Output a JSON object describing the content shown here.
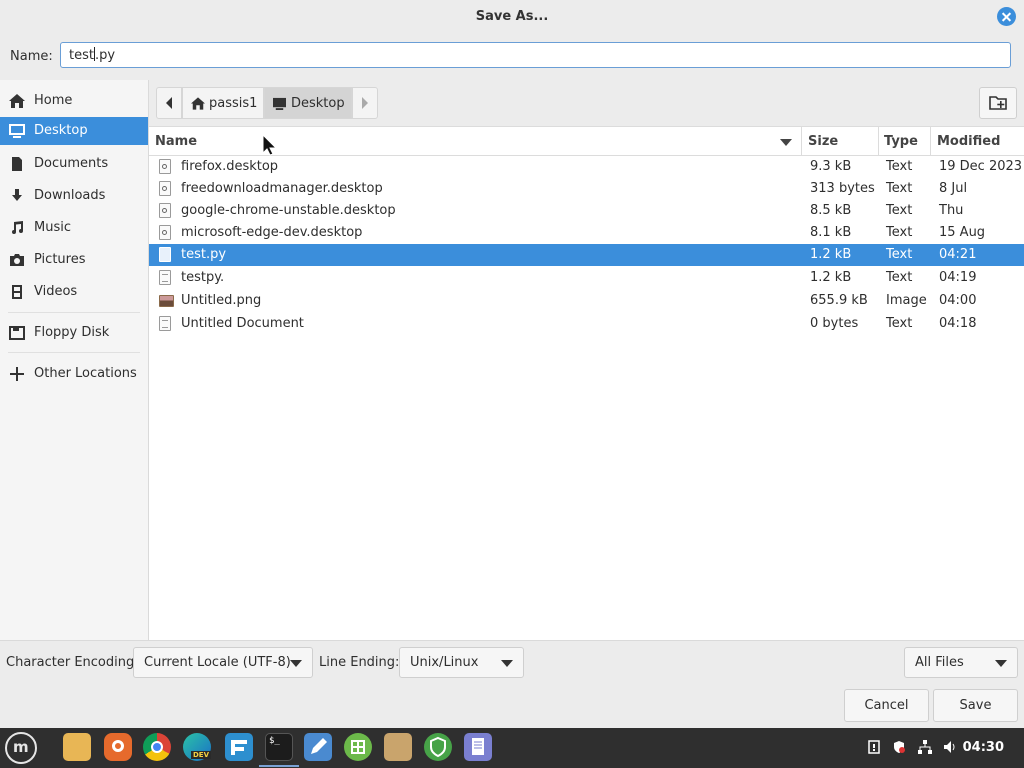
{
  "window": {
    "title": "Save As..."
  },
  "name_row": {
    "label": "Name:",
    "value_before_caret": "test",
    "value_after_caret": ".py"
  },
  "sidebar": {
    "items": [
      {
        "label": "Home",
        "icon": "home-icon"
      },
      {
        "label": "Desktop",
        "icon": "desktop-icon",
        "active": true
      },
      {
        "label": "Documents",
        "icon": "documents-icon"
      },
      {
        "label": "Downloads",
        "icon": "downloads-icon"
      },
      {
        "label": "Music",
        "icon": "music-icon"
      },
      {
        "label": "Pictures",
        "icon": "pictures-icon"
      },
      {
        "label": "Videos",
        "icon": "videos-icon"
      },
      {
        "label": "Floppy Disk",
        "icon": "floppy-disk-icon"
      },
      {
        "label": "Other Locations",
        "icon": "plus-icon"
      }
    ]
  },
  "pathbar": {
    "crumbs": [
      "passis1",
      "Desktop"
    ]
  },
  "file_list": {
    "columns": [
      "Name",
      "Size",
      "Type",
      "Modified"
    ],
    "rows": [
      {
        "name": "firefox.desktop",
        "size": "9.3 kB",
        "type": "Text",
        "modified": "19 Dec 2023",
        "icon": "desktop-file-icon"
      },
      {
        "name": "freedownloadmanager.desktop",
        "size": "313 bytes",
        "type": "Text",
        "modified": "8 Jul",
        "icon": "desktop-file-icon"
      },
      {
        "name": "google-chrome-unstable.desktop",
        "size": "8.5 kB",
        "type": "Text",
        "modified": "Thu",
        "icon": "desktop-file-icon"
      },
      {
        "name": "microsoft-edge-dev.desktop",
        "size": "8.1 kB",
        "type": "Text",
        "modified": "15 Aug",
        "icon": "desktop-file-icon"
      },
      {
        "name": "test.py",
        "size": "1.2 kB",
        "type": "Text",
        "modified": "04:21",
        "icon": "python-file-icon",
        "selected": true
      },
      {
        "name": "testpy.",
        "size": "1.2 kB",
        "type": "Text",
        "modified": "04:19",
        "icon": "text-file-icon"
      },
      {
        "name": "Untitled.png",
        "size": "655.9 kB",
        "type": "Image",
        "modified": "04:00",
        "icon": "image-file-icon"
      },
      {
        "name": "Untitled Document",
        "size": "0 bytes",
        "type": "Text",
        "modified": "04:18",
        "icon": "text-file-icon"
      }
    ]
  },
  "options": {
    "encoding_label": "Character Encoding:",
    "encoding_value": "Current Locale (UTF-8)",
    "line_ending_label": "Line Ending:",
    "line_ending_value": "Unix/Linux",
    "filter_value": "All Files"
  },
  "buttons": {
    "cancel": "Cancel",
    "save": "Save"
  },
  "taskbar": {
    "apps": [
      "mint-menu-icon",
      "files-icon",
      "firefox-icon",
      "chrome-icon",
      "edge-dev-icon",
      "download-manager-icon",
      "terminal-icon",
      "text-editor-icon",
      "spreadsheet-icon",
      "file-manager-icon",
      "shield-icon",
      "document-viewer-icon"
    ],
    "edge_badge": "DEV",
    "terminal_glyph": "$_",
    "clock": "04:30"
  },
  "colors": {
    "accent": "#3b8edb",
    "taskbar": "#2f2f2f"
  }
}
